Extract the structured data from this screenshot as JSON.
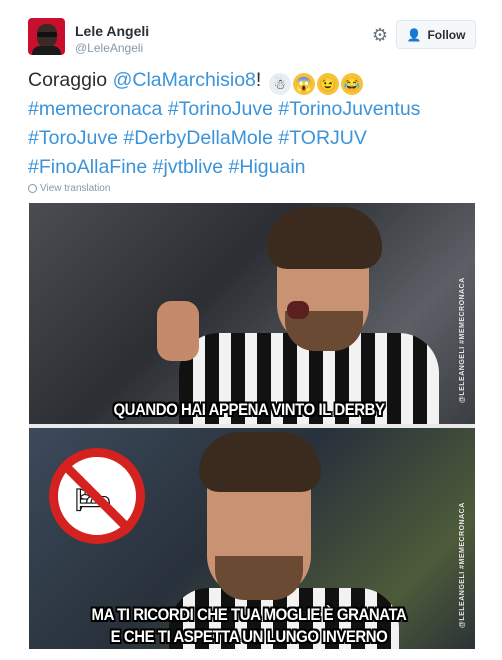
{
  "user": {
    "name": "Lele Angeli",
    "handle": "@LeleAngeli"
  },
  "actions": {
    "follow_label": "Follow"
  },
  "tweet": {
    "text_prefix": "Coraggio ",
    "mention": "@ClaMarchisio8",
    "text_suffix": "!",
    "hashtags_line1": [
      "#memecronaca",
      "#TorinoJuve",
      "#TorinoJuventus"
    ],
    "hashtags_line2": [
      "#ToroJuve",
      "#DerbyDellaMole",
      "#TORJUV"
    ],
    "hashtags_line3": [
      "#FinoAllaFine",
      "#jvtblive",
      "#Higuain"
    ],
    "translate_label": "View translation"
  },
  "media": {
    "caption_top": "QUANDO HAI APPENA VINTO IL DERBY",
    "caption_bottom_line1": "MA TI RICORDI CHE TUA MOGLIE È GRANATA",
    "caption_bottom_line2": "E CHE TI ASPETTA UN LUNGO INVERNO",
    "watermark": "@LELEANGELI  #MEMECRONACA"
  },
  "colors": {
    "link": "#3b94d9",
    "text": "#292f33",
    "muted": "#8899a6",
    "no_sign": "#d3221f"
  }
}
